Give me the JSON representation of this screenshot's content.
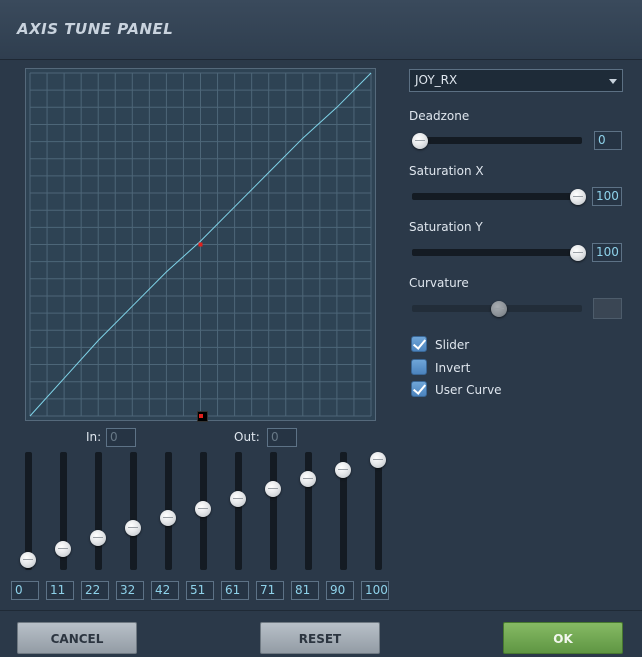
{
  "title": "AXIS TUNE PANEL",
  "axis_select": {
    "selected": "JOY_RX"
  },
  "in_label": "In:",
  "in_value": "0",
  "out_label": "Out:",
  "out_value": "0",
  "curve_points": [
    {
      "value": "0",
      "level": 0
    },
    {
      "value": "11",
      "level": 11
    },
    {
      "value": "22",
      "level": 22
    },
    {
      "value": "32",
      "level": 32
    },
    {
      "value": "42",
      "level": 42
    },
    {
      "value": "51",
      "level": 51
    },
    {
      "value": "61",
      "level": 61
    },
    {
      "value": "71",
      "level": 71
    },
    {
      "value": "81",
      "level": 81
    },
    {
      "value": "90",
      "level": 90
    },
    {
      "value": "100",
      "level": 100
    }
  ],
  "deadzone": {
    "label": "Deadzone",
    "value": "0",
    "level": 0
  },
  "saturation_x": {
    "label": "Saturation X",
    "value": "100",
    "level": 100
  },
  "saturation_y": {
    "label": "Saturation Y",
    "value": "100",
    "level": 100
  },
  "curvature": {
    "label": "Curvature",
    "value": "",
    "level": 50,
    "enabled": false
  },
  "options": [
    {
      "label": "Slider",
      "checked": true
    },
    {
      "label": "Invert",
      "checked": false
    },
    {
      "label": "User Curve",
      "checked": true
    }
  ],
  "buttons": {
    "cancel": "CANCEL",
    "reset": "RESET",
    "ok": "OK"
  },
  "colors": {
    "curve": "#7fd3e8",
    "grid": "#4d6678",
    "ok_button": "#6fa54f",
    "input_text": "#8ed2ea"
  }
}
